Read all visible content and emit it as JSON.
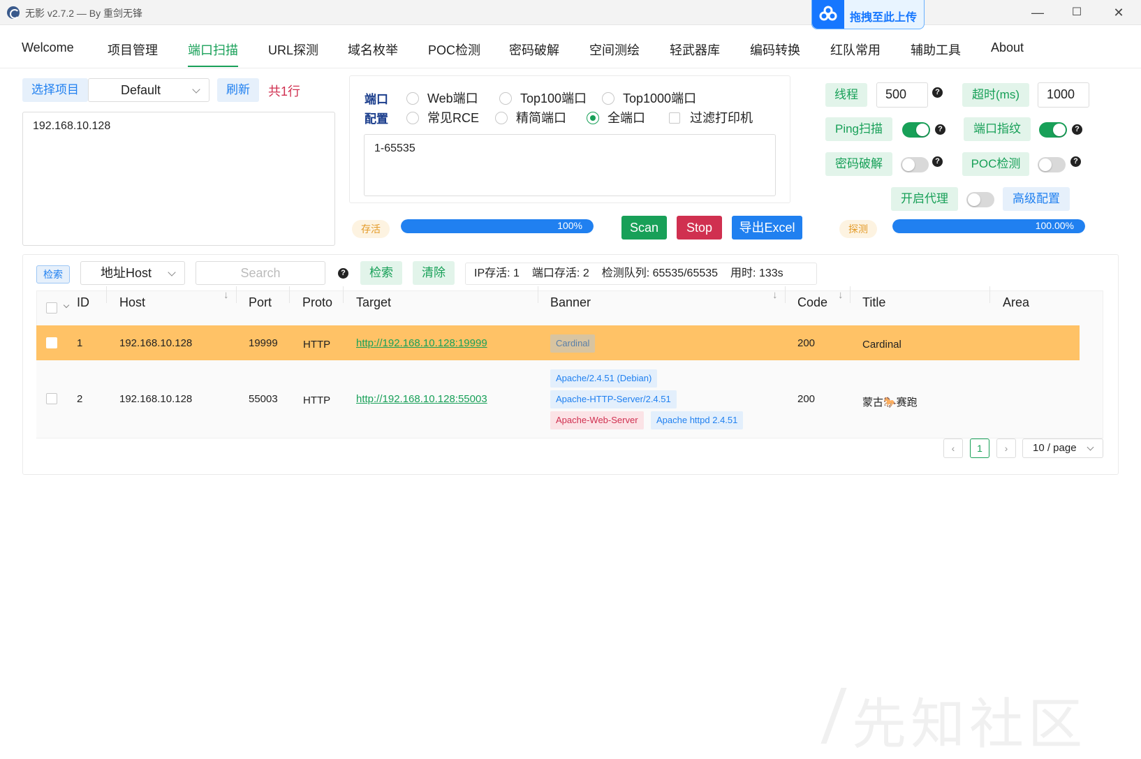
{
  "window": {
    "title": "无影 v2.7.2 — By 重剑无锋",
    "upload_label": "拖拽至此上传",
    "min": "—",
    "max": "☐",
    "close": "✕"
  },
  "menu": {
    "items": [
      "Welcome",
      "项目管理",
      "端口扫描",
      "URL探测",
      "域名枚举",
      "POC检测",
      "密码破解",
      "空间测绘",
      "轻武器库",
      "编码转换",
      "红队常用",
      "辅助工具",
      "About"
    ],
    "active_index": 2
  },
  "project": {
    "select_label": "选择项目",
    "select_value": "Default",
    "refresh_label": "刷新",
    "count_label": "共1行",
    "targets_text": "192.168.10.128"
  },
  "ports": {
    "config_label_1": "端口",
    "config_label_2": "配置",
    "options_row1": [
      "Web端口",
      "Top100端口",
      "Top1000端口"
    ],
    "options_row2": [
      "常见RCE",
      "精简端口",
      "全端口"
    ],
    "selected": "全端口",
    "filter_printer_label": "过滤打印机",
    "range_text": "1-65535"
  },
  "settings": {
    "threads_label": "线程",
    "threads_value": "500",
    "timeout_label": "超时(ms)",
    "timeout_value": "1000",
    "ping_label": "Ping扫描",
    "ping_on": true,
    "fingerprint_label": "端口指纹",
    "fingerprint_on": true,
    "brute_label": "密码破解",
    "brute_on": false,
    "poc_label": "POC检测",
    "poc_on": false,
    "proxy_label": "开启代理",
    "proxy_on": false,
    "advanced_label": "高级配置",
    "help_glyph": "?"
  },
  "progress": {
    "alive_label": "存活",
    "alive_percent_text": "100%",
    "alive_value": 1.0,
    "detect_label": "探测",
    "detect_percent_text": "100.00%",
    "detect_value": 1.0
  },
  "actions": {
    "scan_label": "Scan",
    "stop_label": "Stop",
    "export_label": "导出Excel",
    "scan_color": "#18a058",
    "stop_color": "#d03050",
    "export_color": "#2080f0"
  },
  "filter": {
    "search_tag": "检索",
    "field_value": "地址Host",
    "search_placeholder": "Search",
    "search_btn": "检索",
    "clear_btn": "清除",
    "stats": {
      "ip_alive": "IP存活: 1",
      "port_alive": "端口存活: 2",
      "queue": "检测队列: 65535/65535",
      "elapsed": "用时: 133s"
    }
  },
  "table": {
    "headers": {
      "id": "ID",
      "host": "Host",
      "port": "Port",
      "proto": "Proto",
      "target": "Target",
      "banner": "Banner",
      "code": "Code",
      "title": "Title",
      "area": "Area"
    },
    "sort_glyph": "↓",
    "highlight_color": "#ffc266",
    "rows": [
      {
        "id": "1",
        "host": "192.168.10.128",
        "port": "19999",
        "proto": "HTTP",
        "target": "http://192.168.10.128:19999",
        "banners": [
          "Cardinal"
        ],
        "code": "200",
        "title": "Cardinal",
        "area": ""
      },
      {
        "id": "2",
        "host": "192.168.10.128",
        "port": "55003",
        "proto": "HTTP",
        "target": "http://192.168.10.128:55003",
        "banners": [
          "Apache/2.4.51 (Debian)",
          "Apache-HTTP-Server/2.4.51",
          "Apache-Web-Server",
          "Apache httpd 2.4.51"
        ],
        "code": "200",
        "title": "蒙古🐎赛跑",
        "area": ""
      }
    ]
  },
  "pager": {
    "prev": "‹",
    "page": "1",
    "next": "›",
    "size_label": "10 / page"
  },
  "watermark": "先知社区"
}
